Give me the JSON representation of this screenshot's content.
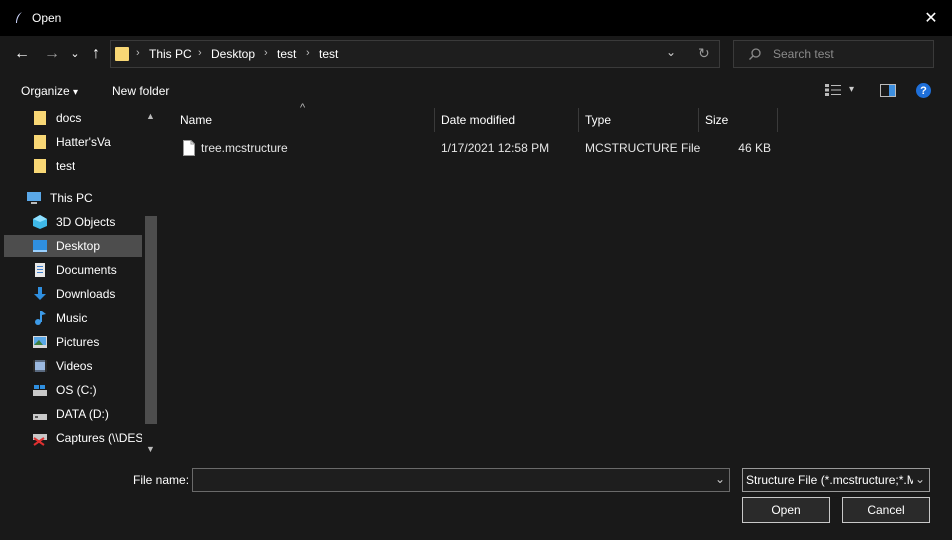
{
  "window": {
    "title": "Open",
    "close_glyph": "✕"
  },
  "nav": {
    "back": "←",
    "forward": "→",
    "recent": "⌄",
    "up": "↑"
  },
  "address": {
    "crumbs": [
      "This PC",
      "Desktop",
      "test",
      "test"
    ],
    "separator": "›",
    "dropdown_glyph": "⌄",
    "refresh_glyph": "↻"
  },
  "search": {
    "placeholder": "Search test",
    "icon": "search-icon"
  },
  "toolbar": {
    "organize": "Organize",
    "organize_arrow": "▾",
    "new_folder": "New folder",
    "help": "?",
    "view_arrow": "▾"
  },
  "sidebar": {
    "items": [
      {
        "label": "docs",
        "icon": "folder-icon"
      },
      {
        "label": "Hatter'sVa",
        "icon": "folder-icon"
      },
      {
        "label": "test",
        "icon": "folder-icon"
      },
      {
        "label": "This PC",
        "icon": "computer-icon"
      },
      {
        "label": "3D Objects",
        "icon": "cube-icon"
      },
      {
        "label": "Desktop",
        "icon": "desktop-icon"
      },
      {
        "label": "Documents",
        "icon": "documents-icon"
      },
      {
        "label": "Downloads",
        "icon": "downloads-icon"
      },
      {
        "label": "Music",
        "icon": "music-icon"
      },
      {
        "label": "Pictures",
        "icon": "pictures-icon"
      },
      {
        "label": "Videos",
        "icon": "videos-icon"
      },
      {
        "label": "OS (C:)",
        "icon": "drive-icon"
      },
      {
        "label": "DATA (D:)",
        "icon": "drive-icon"
      },
      {
        "label": "Captures (\\\\DESI",
        "icon": "network-drive-icon"
      }
    ],
    "selected": "Desktop"
  },
  "columns": {
    "name": "Name",
    "date": "Date modified",
    "type": "Type",
    "size": "Size",
    "sort_glyph": "^"
  },
  "files": [
    {
      "name": "tree.mcstructure",
      "date": "1/17/2021 12:58 PM",
      "type": "MCSTRUCTURE File",
      "size": "46 KB"
    }
  ],
  "bottom": {
    "file_name_label": "File name:",
    "file_name_value": "",
    "filter": "Structure File (*.mcstructure;*.M",
    "dropdown_glyph": "⌄",
    "open": "Open",
    "cancel": "Cancel"
  },
  "colors": {
    "accent": "#0078d7",
    "folder": "#f8d775",
    "help": "#1e6fd9"
  }
}
